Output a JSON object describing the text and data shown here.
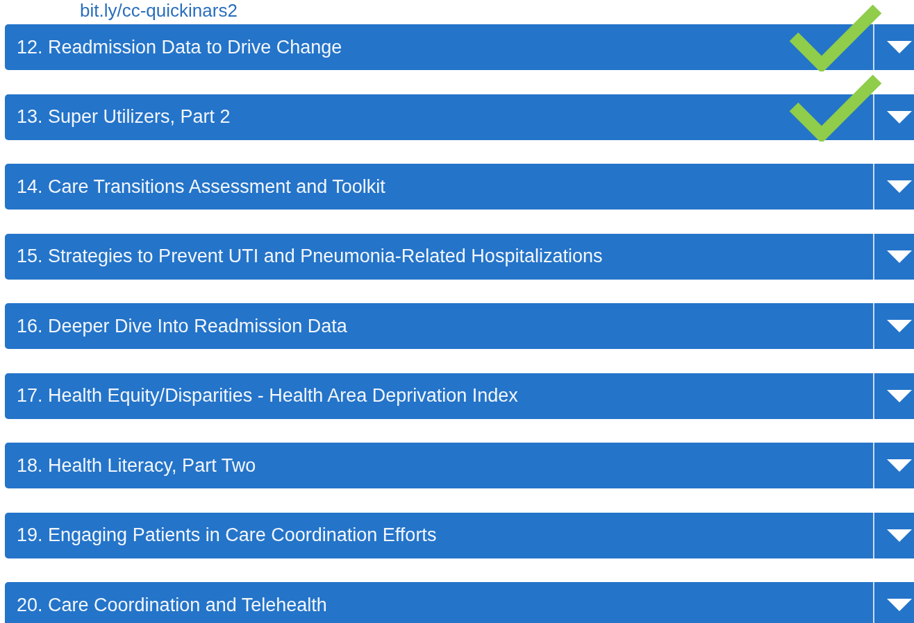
{
  "link": {
    "text": "bit.ly/cc-quickinars2"
  },
  "items": [
    {
      "title": "12. Readmission Data to Drive Change",
      "checked": true
    },
    {
      "title": "13. Super Utilizers, Part 2",
      "checked": true
    },
    {
      "title": "14. Care Transitions Assessment and Toolkit",
      "checked": false
    },
    {
      "title": "15. Strategies to Prevent UTI and Pneumonia-Related Hospitalizations",
      "checked": false
    },
    {
      "title": "16. Deeper Dive Into Readmission Data",
      "checked": false
    },
    {
      "title": "17. Health Equity/Disparities - Health Area Deprivation Index",
      "checked": false
    },
    {
      "title": "18. Health Literacy, Part Two",
      "checked": false
    },
    {
      "title": "19. Engaging Patients in Care Coordination Efforts",
      "checked": false
    },
    {
      "title": "20. Care Coordination and Telehealth",
      "checked": false
    }
  ]
}
